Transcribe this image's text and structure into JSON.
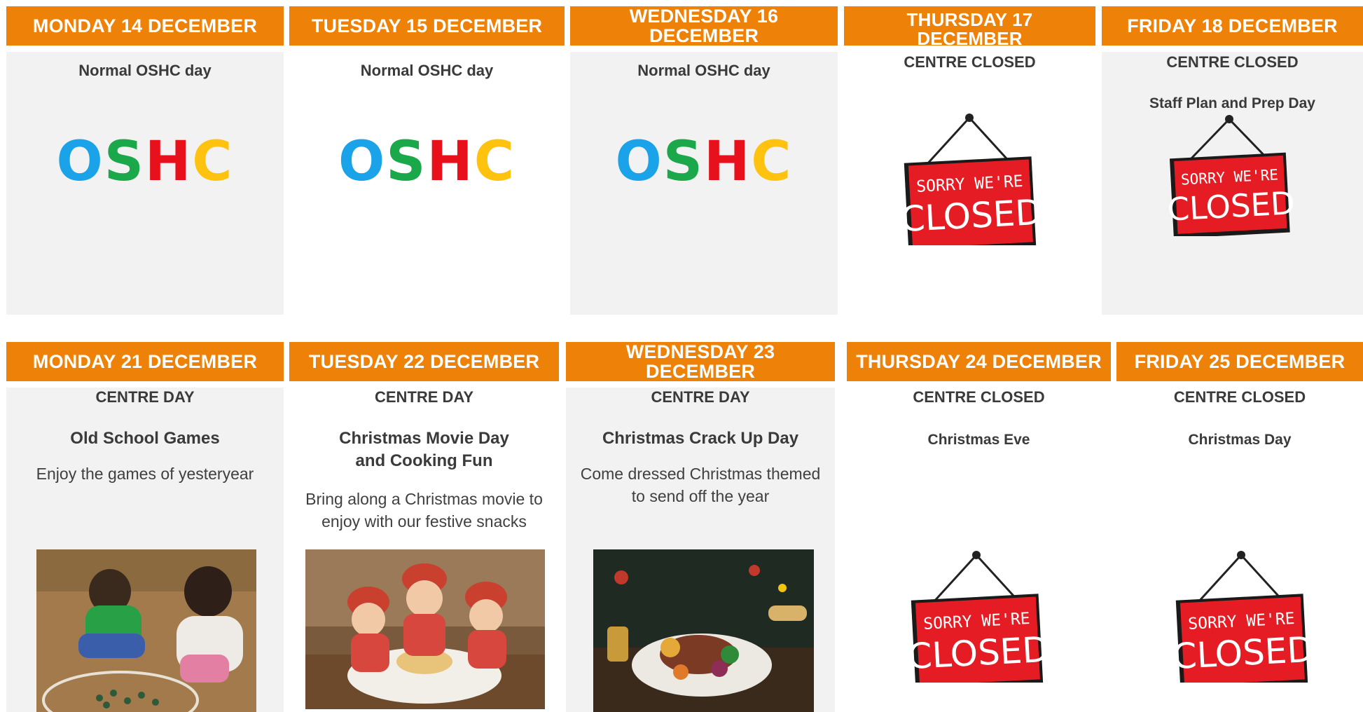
{
  "colors": {
    "header_bg": "#ee8208",
    "card_bg": "#f2f2f2",
    "oshc_letters": [
      "#1aa3e8",
      "#1aa84a",
      "#e8101a",
      "#ffc20e"
    ],
    "closed_sign_red": "#e51c23"
  },
  "week1": {
    "monday": {
      "header": "MONDAY 14 DECEMBER",
      "status": "Normal OSHC day",
      "logo": "OSHC"
    },
    "tuesday": {
      "header": "TUESDAY 15 DECEMBER",
      "status": "Normal OSHC day",
      "logo": "OSHC"
    },
    "wednesday": {
      "header": "WEDNESDAY 16 DECEMBER",
      "status": "Normal OSHC day",
      "logo": "OSHC"
    },
    "thursday": {
      "header_line1": "THURSDAY 17",
      "header_line2": "DECEMBER",
      "status": "CENTRE CLOSED"
    },
    "friday": {
      "header": "FRIDAY 18 DECEMBER",
      "status": "CENTRE CLOSED",
      "subtitle": "Staff Plan and Prep Day"
    }
  },
  "week2": {
    "monday": {
      "header": "MONDAY 21 DECEMBER",
      "status": "CENTRE DAY",
      "title": "Old School Games",
      "description": "Enjoy the games of yesteryear",
      "image": "children-playing-marbles-photo"
    },
    "tuesday": {
      "header": "TUESDAY 22 DECEMBER",
      "status": "CENTRE DAY",
      "title_line1": "Christmas Movie Day",
      "title_line2": "and Cooking Fun",
      "description_line1": "Bring along a Christmas movie to",
      "description_line2": "enjoy with our festive snacks",
      "image": "children-baking-photo"
    },
    "wednesday": {
      "header": "WEDNESDAY 23 DECEMBER",
      "status": "CENTRE DAY",
      "title": "Christmas Crack Up Day",
      "description_line1": "Come dressed Christmas themed",
      "description_line2": "to send off the year",
      "image": "christmas-dinner-photo"
    },
    "thursday": {
      "header": "THURSDAY 24 DECEMBER",
      "status": "CENTRE CLOSED",
      "subtitle": "Christmas Eve"
    },
    "friday": {
      "header": "FRIDAY 25 DECEMBER",
      "status": "CENTRE CLOSED",
      "subtitle": "Christmas Day"
    }
  },
  "closed_sign": {
    "line1": "SORRY WE'RE",
    "line2": "CLOSED"
  }
}
